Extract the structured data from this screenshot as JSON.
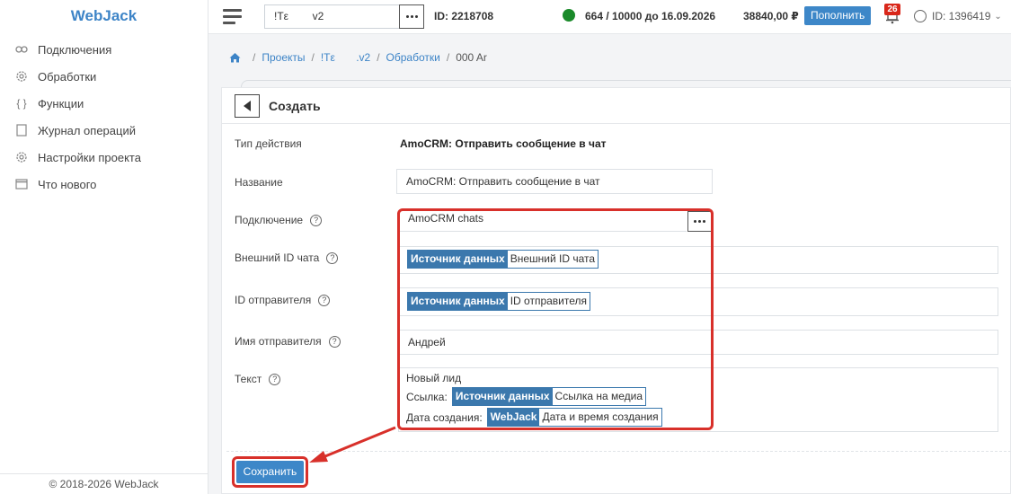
{
  "brand": "WebJack",
  "sidebar": {
    "items": [
      {
        "label": "Подключения",
        "icon": "link-icon"
      },
      {
        "label": "Обработки",
        "icon": "gear-icon"
      },
      {
        "label": "Функции",
        "icon": "braces-icon"
      },
      {
        "label": "Журнал операций",
        "icon": "journal-icon"
      },
      {
        "label": "Настройки проекта",
        "icon": "settings-icon"
      },
      {
        "label": "Что нового",
        "icon": "calendar-icon"
      }
    ],
    "copyright": "© 2018-2026 WebJack"
  },
  "header": {
    "project": "!Tε        v2",
    "project_id": "ID: 2218708",
    "limit": "664 / 10000 до 16.09.2026",
    "balance": "38840,00 ₽",
    "topup": "Пополнить",
    "notifications": "26",
    "user": "ID: 1396419",
    "status_color": "#1a8a2a"
  },
  "breadcrumb": {
    "items": [
      "Проекты",
      "!Tε       .v2",
      "Обработки"
    ],
    "current": "000 Ar"
  },
  "form": {
    "title": "Создать",
    "action_type_label": "Тип действия",
    "action_type_value": "AmoCRM: Отправить сообщение в чат",
    "name_label": "Название",
    "name_value": "AmoCRM: Отправить сообщение в чат",
    "connection_label": "Подключение",
    "connection_value": "AmoCRM chats",
    "chat_id_label": "Внешний ID чата",
    "chat_id_token": {
      "source": "Источник данных",
      "field": "Внешний ID чата"
    },
    "sender_id_label": "ID отправителя",
    "sender_id_token": {
      "source": "Источник данных",
      "field": "ID отправителя"
    },
    "sender_name_label": "Имя отправителя",
    "sender_name_value": "Андрей",
    "text_label": "Текст",
    "text_line1": "Новый лид",
    "text_line2_prefix": "Ссылка:",
    "text_line2_token": {
      "source": "Источник данных",
      "field": "Ссылка на медиа"
    },
    "text_line3_prefix": "Дата создания:",
    "text_line3_token": {
      "source": "WebJack",
      "field": "Дата и время создания"
    },
    "save": "Сохранить"
  },
  "colors": {
    "accent": "#3d87c8",
    "token": "#3b78ad",
    "highlight": "#d8302a"
  }
}
